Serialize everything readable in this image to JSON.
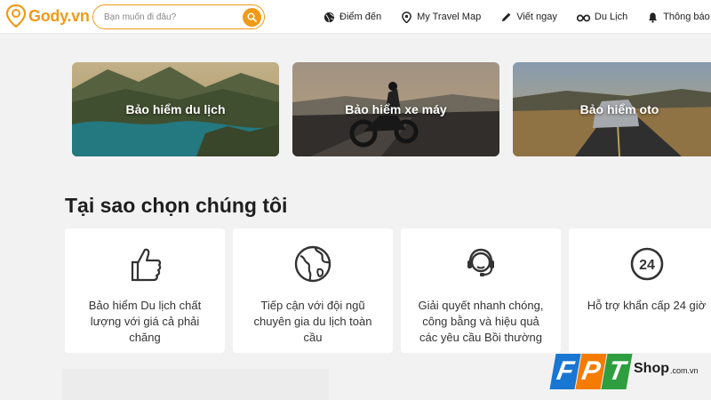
{
  "header": {
    "logo_text": "Gody.vn",
    "search_placeholder": "Bạn muốn đi đâu?",
    "nav": [
      {
        "label": "Điểm đến",
        "icon": "globe-icon"
      },
      {
        "label": "My Travel Map",
        "icon": "map-pin-icon"
      },
      {
        "label": "Viết ngay",
        "icon": "pencil-icon"
      },
      {
        "label": "Du Lịch",
        "icon": "binoculars-icon"
      },
      {
        "label": "Thông báo",
        "icon": "bell-icon"
      }
    ]
  },
  "categories": [
    {
      "label": "Bảo hiểm du lịch"
    },
    {
      "label": "Bảo hiểm xe máy"
    },
    {
      "label": "Bảo hiểm oto"
    }
  ],
  "why_section": {
    "title": "Tại sao chọn chúng tôi",
    "features": [
      {
        "icon": "thumbs-up-icon",
        "text": "Bảo hiểm Du lịch chất lượng với giá cả phải chăng"
      },
      {
        "icon": "globe-icon",
        "text": "Tiếp cận với đội ngũ chuyên gia du lịch toàn cầu"
      },
      {
        "icon": "headset-icon",
        "text": "Giải quyết nhanh chóng, công bằng và hiệu quả các yêu cầu Bồi thường"
      },
      {
        "icon": "clock-24-icon",
        "text": "Hỗ trợ khẩn cấp 24 giờ"
      }
    ]
  },
  "watermark": {
    "letters": [
      "F",
      "P",
      "T"
    ],
    "shop": "Shop",
    "domain": ".com.vn",
    "colors": [
      "#1976d2",
      "#f57c00",
      "#2e9e3f"
    ]
  },
  "colors": {
    "accent": "#f29a17"
  }
}
